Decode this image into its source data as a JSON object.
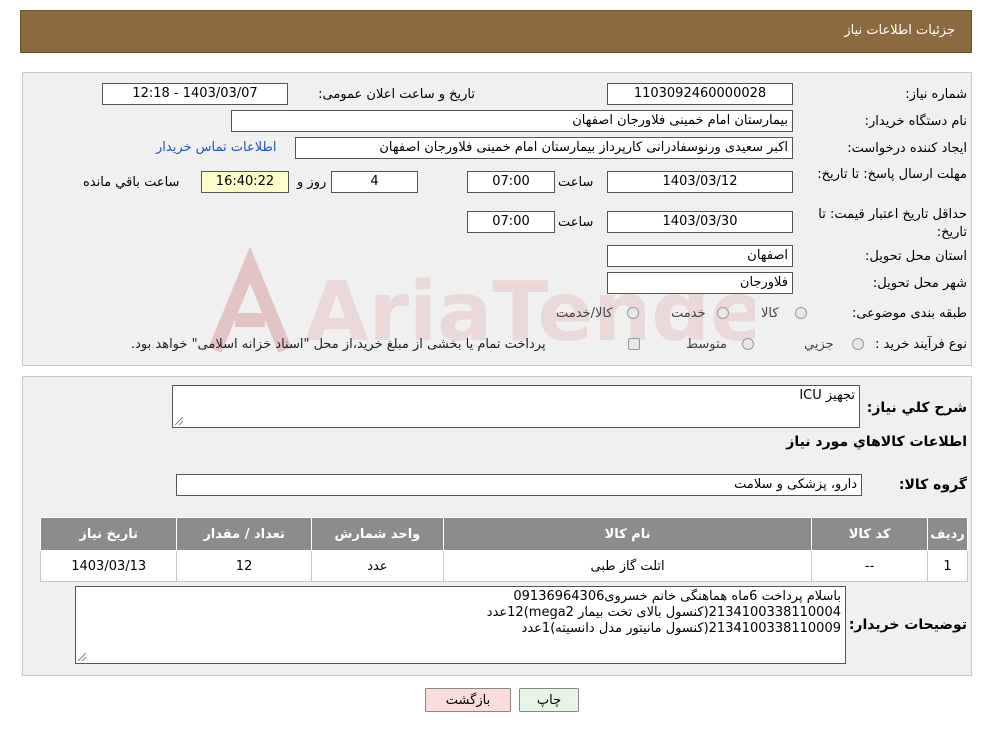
{
  "header": {
    "title": "جزئیات اطلاعات نیاز"
  },
  "details": {
    "need_number_label": "شماره نیاز:",
    "need_number": "1103092460000028",
    "announce_label": "تاریخ و ساعت اعلان عمومی:",
    "announce_value": "1403/03/07 - 12:18",
    "buyer_org_label": "نام دستگاه خریدار:",
    "buyer_org": "بیمارستان امام خمینی فلاورجان اصفهان",
    "creator_label": "ایجاد کننده درخواست:",
    "creator": "اکبر سعیدی ورنوسفادرانی کارپرداز بیمارستان امام خمینی فلاورجان اصفهان",
    "contact_link": "اطلاعات تماس خریدار",
    "deadline_label": "مهلت ارسال پاسخ: تا تاریخ:",
    "deadline_date": "1403/03/12",
    "time_label": "ساعت",
    "deadline_time": "07:00",
    "days_value": "4",
    "days_label": "روز و",
    "remaining_time": "16:40:22",
    "remaining_label": "ساعت باقي مانده",
    "validity_label": "حداقل تاریخ اعتبار قیمت: تا تاریخ:",
    "validity_date": "1403/03/30",
    "validity_time": "07:00",
    "province_label": "استان محل تحویل:",
    "province": "اصفهان",
    "city_label": "شهر محل تحویل:",
    "city": "فلاورجان",
    "category_label": "طبقه بندی موضوعی:",
    "category_options": [
      "کالا",
      "خدمت",
      "کالا/خدمت"
    ],
    "process_label": "نوع فرآیند خرید :",
    "process_options": [
      "جزيي",
      "متوسط"
    ],
    "process_note": "پرداخت تمام یا بخشی از مبلغ خرید،از محل \"اسناد خزانه اسلامی\" خواهد بود."
  },
  "summary": {
    "label": "شرح کلي نياز:",
    "value": "تجهیز ICU",
    "goods_info_title": "اطلاعات كالاهاي مورد نياز",
    "group_label": "گروه کالا:",
    "group_value": "دارو، پزشکی و سلامت"
  },
  "table": {
    "headers": [
      "رديف",
      "کد کالا",
      "نام کالا",
      "واحد شمارش",
      "تعداد / مقدار",
      "تاریخ نیاز"
    ],
    "rows": [
      [
        "1",
        "--",
        "اتلت گاز طبی",
        "عدد",
        "12",
        "1403/03/13"
      ]
    ]
  },
  "buyer_notes": {
    "label": "توضیحات خریدار:",
    "lines": [
      "باسلام پرداخت 6ماه هماهنگی خانم خسروی09136964306",
      "2134100338110004(کنسول بالای تخت بیمار mega2)12عدد",
      "2134100338110009(کنسول مانیتور مدل دانسیته)1عدد"
    ]
  },
  "buttons": {
    "print": "چاپ",
    "back": "بازگشت"
  },
  "watermark": {
    "text": "AriaTender.neT"
  },
  "colors": {
    "header": "#8c6a3f",
    "table_header": "#8c8c8c",
    "link": "#1f55c8",
    "back_button": "#fbdcdc",
    "print_button": "#e6f6e6"
  }
}
